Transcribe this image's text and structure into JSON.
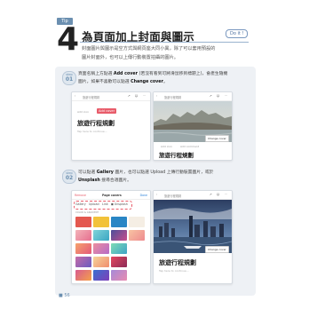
{
  "header": {
    "tip_label": "Tip",
    "number": "4",
    "title": "為頁面加上封面與圖示",
    "do_it": "Do it !"
  },
  "intro": [
    "封面圖片與圖示是空方式與網頁座大同小異，除了可以套用預設的",
    "圖片封面外，也可以上傳行動裝置拍攝的圖片。"
  ],
  "steps": [
    {
      "label": "step",
      "num": "01",
      "lines": [
        {
          "pre": "頁面名稱上方點選 ",
          "bold": "Add cover",
          "post": " (若沒有看到可將滑鼠移到標題上)，會產生隨機"
        },
        {
          "pre": "圖片，如果不喜歡可以點選 ",
          "bold": "Change cover",
          "post": "。"
        }
      ]
    },
    {
      "label": "step",
      "num": "02",
      "lines": [
        {
          "pre": "可以點選 ",
          "bold": "Gallery",
          "post": " 圖片，也可以點選 Upload 上傳行動裝置圖片，或於"
        },
        {
          "pre": "",
          "bold": "Unsplash",
          "post": " 搜尋合適圖片。"
        }
      ]
    }
  ],
  "mockup": {
    "bar_title": "旅遊行程規劃",
    "page_title": "旅遊行程規劃",
    "hint": "Tap here to continue...",
    "add_icon": "Add icon",
    "add_cover": "Add cover",
    "add_comment": "Add comment",
    "change_cover": "Change cover",
    "remove": "Remove",
    "page_cover": "Page covers",
    "done": "Done",
    "gallery": "Gallery",
    "upload": "Upload",
    "link": "Link",
    "unsplash": "Unsplash",
    "color_gradient": "COLOR & GRADIENT"
  },
  "page_number": "56",
  "colors": {
    "accent": "#6b8fb0",
    "cover_red": "#e85c6a"
  }
}
